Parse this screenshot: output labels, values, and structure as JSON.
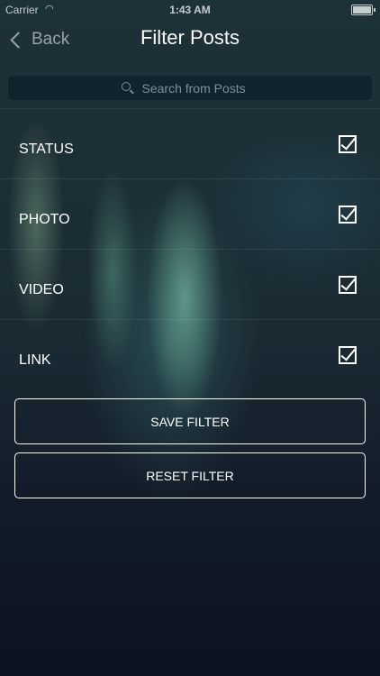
{
  "status_bar": {
    "carrier": "Carrier",
    "time": "1:43 AM"
  },
  "nav": {
    "back_label": "Back",
    "title": "Filter Posts"
  },
  "search": {
    "placeholder": "Search from Posts",
    "value": ""
  },
  "filters": [
    {
      "label": "STATUS",
      "checked": true
    },
    {
      "label": "PHOTO",
      "checked": true
    },
    {
      "label": "VIDEO",
      "checked": true
    },
    {
      "label": "LINK",
      "checked": true
    }
  ],
  "actions": {
    "save_label": "SAVE FILTER",
    "reset_label": "RESET FILTER"
  },
  "colors": {
    "text": "#ffffff",
    "search_bg": "#0e222c",
    "background_dark": "#0c1220",
    "aurora_accent": "#8cdcbe"
  },
  "icons": {
    "back": "chevron-left-icon",
    "search": "search-icon",
    "checkbox": "checkbox-checked-icon"
  }
}
